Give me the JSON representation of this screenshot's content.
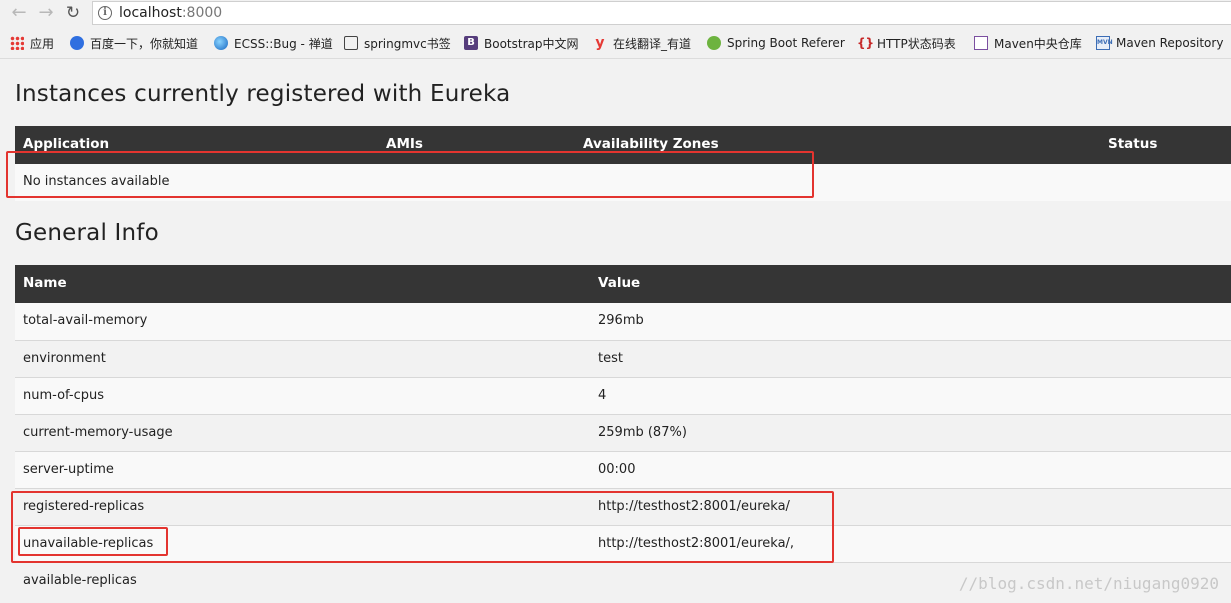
{
  "browser": {
    "url_host": "localhost",
    "url_port": ":8000",
    "bookmarks": [
      {
        "label": "应用",
        "icon": "apps-grid-icon"
      },
      {
        "label": "百度一下，你就知道",
        "icon": "baidu-paw-icon"
      },
      {
        "label": "ECSS::Bug - 禅道",
        "icon": "ecss-globe-icon"
      },
      {
        "label": "springmvc书签",
        "icon": "book-icon"
      },
      {
        "label": "Bootstrap中文网",
        "icon": "bootstrap-icon"
      },
      {
        "label": "在线翻译_有道",
        "icon": "youdao-icon"
      },
      {
        "label": "Spring Boot Referer",
        "icon": "spring-leaf-icon"
      },
      {
        "label": "HTTP状态码表",
        "icon": "braces-icon"
      },
      {
        "label": "Maven中央仓库",
        "icon": "maven-icon"
      },
      {
        "label": "Maven Repository",
        "icon": "mvn-repo-icon"
      }
    ]
  },
  "instances": {
    "title": "Instances currently registered with Eureka",
    "columns": [
      "Application",
      "AMIs",
      "Availability Zones",
      "Status"
    ],
    "empty_text": "No instances available"
  },
  "general": {
    "title": "General Info",
    "columns": [
      "Name",
      "Value"
    ],
    "rows": [
      {
        "name": "total-avail-memory",
        "value": "296mb"
      },
      {
        "name": "environment",
        "value": "test"
      },
      {
        "name": "num-of-cpus",
        "value": "4"
      },
      {
        "name": "current-memory-usage",
        "value": "259mb (87%)"
      },
      {
        "name": "server-uptime",
        "value": "00:00"
      },
      {
        "name": "registered-replicas",
        "value": "http://testhost2:8001/eureka/"
      },
      {
        "name": "unavailable-replicas",
        "value": "http://testhost2:8001/eureka/,"
      },
      {
        "name": "available-replicas",
        "value": ""
      }
    ]
  },
  "watermark": "//blog.csdn.net/niugang0920",
  "colors": {
    "table_header": "#353535",
    "highlight": "#e3342f",
    "page_bg": "#f2f2f2"
  }
}
